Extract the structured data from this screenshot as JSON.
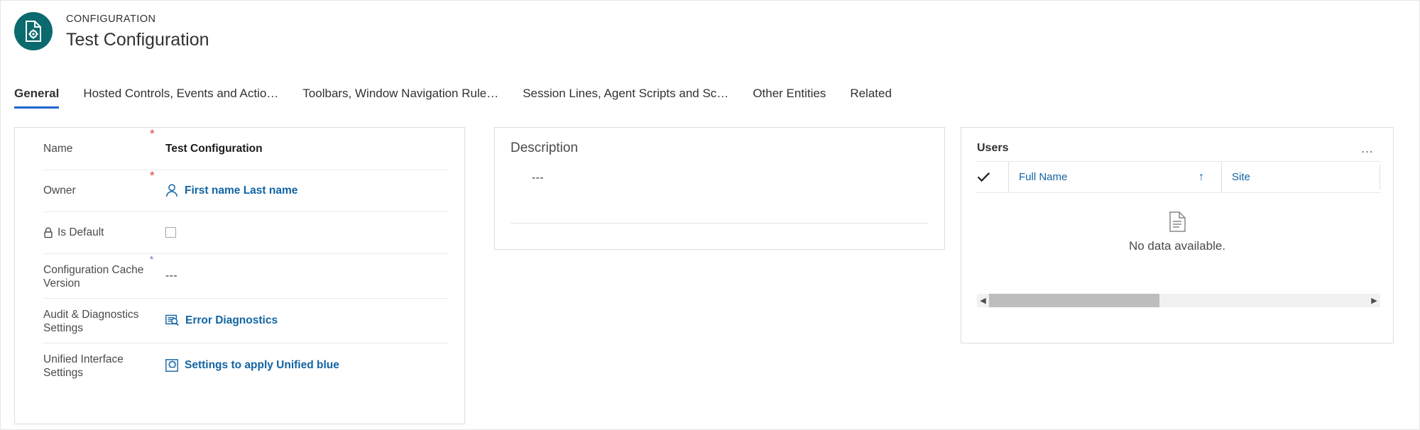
{
  "header": {
    "eyebrow": "CONFIGURATION",
    "title": "Test Configuration",
    "icon_name": "configuration-document-gear-icon",
    "icon_color": "#0b6a6e"
  },
  "tabs": [
    {
      "label": "General",
      "active": true
    },
    {
      "label": "Hosted Controls, Events and Actio…",
      "active": false
    },
    {
      "label": "Toolbars, Window Navigation Rule…",
      "active": false
    },
    {
      "label": "Session Lines, Agent Scripts and Sc…",
      "active": false
    },
    {
      "label": "Other Entities",
      "active": false
    },
    {
      "label": "Related",
      "active": false
    }
  ],
  "form": {
    "rows": [
      {
        "label": "Name",
        "required": "*",
        "value": "Test Configuration",
        "type": "text"
      },
      {
        "label": "Owner",
        "required": "*",
        "value": "First name Last name",
        "type": "link-person"
      },
      {
        "label": "Is Default",
        "required": "",
        "value": "",
        "type": "checkbox",
        "locked": true
      },
      {
        "label": "Configuration Cache Version",
        "required": "*",
        "value": "---",
        "type": "text-dim"
      },
      {
        "label": "Audit & Diagnostics Settings",
        "required": "",
        "value": "Error Diagnostics",
        "type": "link-diagnostics"
      },
      {
        "label": "Unified Interface Settings",
        "required": "",
        "value": "Settings to apply Unified blue",
        "type": "link-puzzle"
      }
    ]
  },
  "description": {
    "title": "Description",
    "value": "---"
  },
  "users": {
    "title": "Users",
    "overflow_label": "…",
    "columns": [
      {
        "label": "Full Name",
        "sort": "↑"
      },
      {
        "label": "Site",
        "sort": ""
      }
    ],
    "empty_message": "No data available.",
    "scroll_left_label": "◀",
    "scroll_right_label": "▶"
  },
  "colors": {
    "accent_teal": "#0b6a6e",
    "link_blue": "#1264a3",
    "tab_underline": "#2266cc",
    "required_red": "#e03c31"
  }
}
